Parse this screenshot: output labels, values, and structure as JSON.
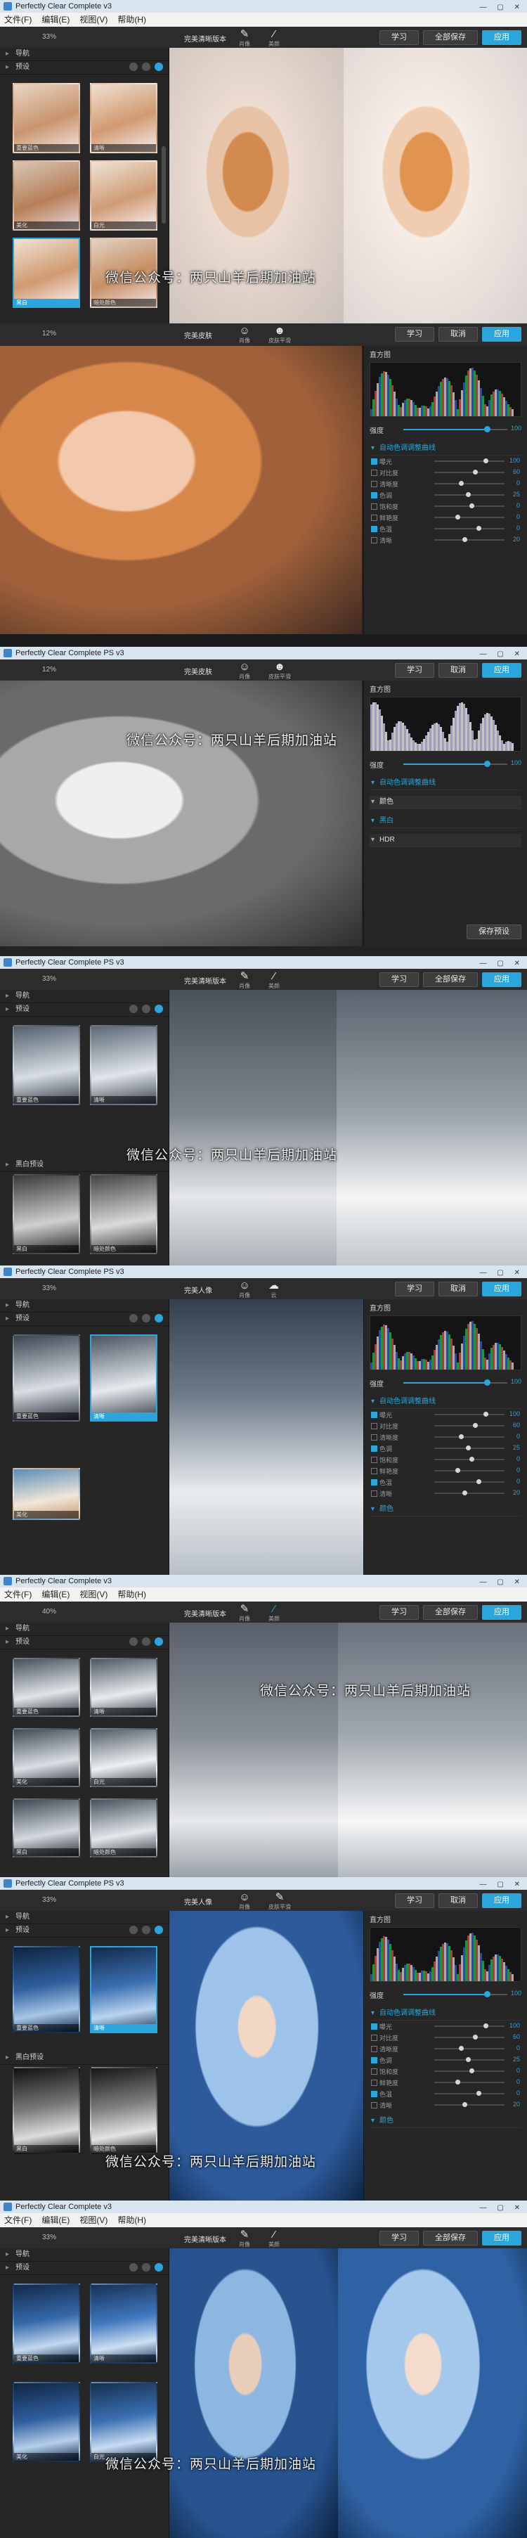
{
  "app": {
    "title": "Perfectly Clear Complete v3",
    "title_ps": "Perfectly Clear Complete PS v3",
    "menu": [
      "文件(F)",
      "编辑(E)",
      "视图(V)",
      "帮助(H)"
    ]
  },
  "left": {
    "nav": "导航",
    "presets": "预设",
    "presets_alt": "黑白预设"
  },
  "modes": {
    "portrait": "肖像",
    "beauty": "美颜",
    "cloud": "云",
    "skin": "皮肤平滑",
    "eye": "眼睛",
    "general": "通用"
  },
  "toolbar": {
    "zoom_a": "33%",
    "zoom_b": "12%",
    "zoom_c": "40%",
    "preset_a": "完美清晰版本",
    "preset_b": "完美皮肤",
    "preset_c": "完美人像"
  },
  "buttons": {
    "learn": "学习",
    "save_all": "全部保存",
    "apply": "应用",
    "cancel": "取消",
    "save_preset": "保存预设"
  },
  "right": {
    "histogram": "直方图",
    "strength": "强度",
    "strength_value": "100",
    "auto_tone": "自动色调调整曲线",
    "color": "颜色",
    "hdr": "HDR",
    "bw": "黑白"
  },
  "sliders": [
    {
      "label": "曝光",
      "value": "100",
      "level": 0.7
    },
    {
      "label": "对比度",
      "value": "60",
      "level": 0.55
    },
    {
      "label": "清晰度",
      "value": "0",
      "level": 0.35
    },
    {
      "label": "色调",
      "value": "25",
      "level": 0.45
    },
    {
      "label": "饱和度",
      "value": "0",
      "level": 0.5
    },
    {
      "label": "鲜艳度",
      "value": "0",
      "level": 0.3
    },
    {
      "label": "色温",
      "value": "0",
      "level": 0.6
    },
    {
      "label": "清晰",
      "value": "20",
      "level": 0.4
    }
  ],
  "thumbs": {
    "t1": "重要蓝色",
    "t2": "清晰",
    "t3": "美化",
    "t4": "白光",
    "t5": "黑白",
    "t6": "暗处颜色"
  },
  "watermark": "微信公众号：两只山羊后期加油站",
  "colors": {
    "accent": "#2aa6dc",
    "panel": "#262626",
    "titlebar": "#d9e4f1"
  }
}
